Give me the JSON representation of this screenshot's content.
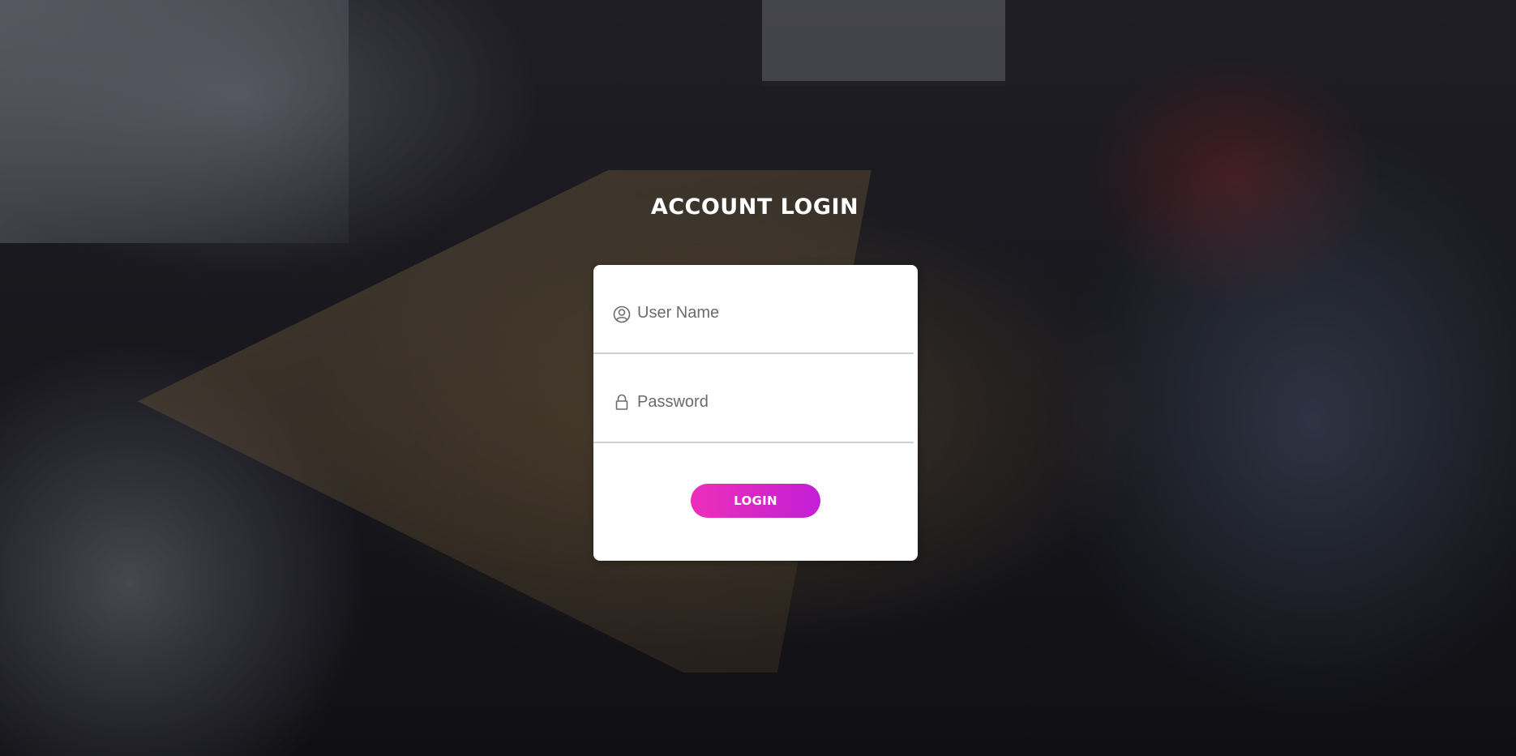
{
  "page": {
    "title": "ACCOUNT LOGIN",
    "background": "photo of people sitting around a conference table"
  },
  "form": {
    "username": {
      "placeholder": "User Name",
      "icon": "user-circle-icon"
    },
    "password": {
      "placeholder": "Password",
      "icon": "lock-icon"
    },
    "submit_label": "LOGIN"
  },
  "colors": {
    "button_start": "#ec2fb9",
    "button_end": "#c21fd6",
    "card": "#ffffff",
    "title": "#ffffff",
    "divider": "#cfcfcf"
  }
}
